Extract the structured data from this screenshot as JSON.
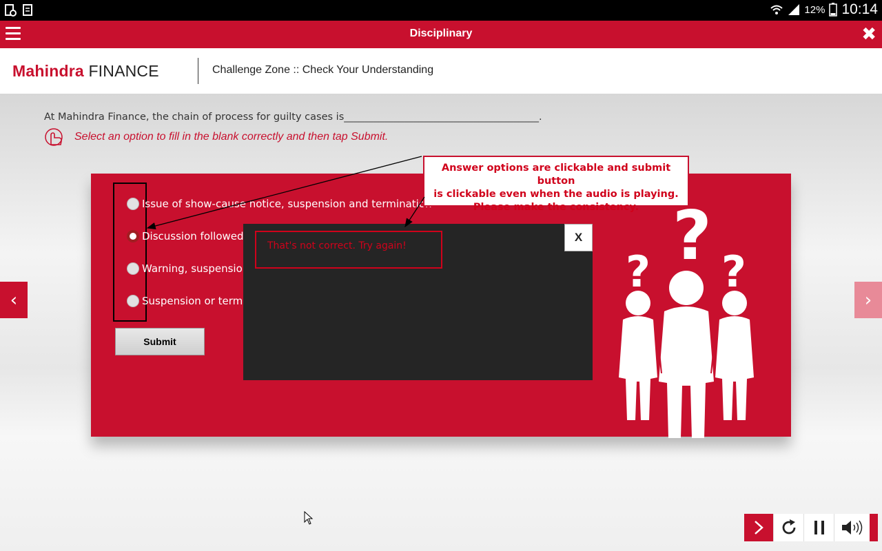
{
  "status_bar": {
    "battery": "12%",
    "time": "10:14"
  },
  "title_bar": {
    "title": "Disciplinary",
    "close_glyph": "✖"
  },
  "header": {
    "logo_brand": "Mahindra",
    "logo_finance": "FINANCE",
    "title": "Challenge Zone :: Check Your Understanding"
  },
  "question": {
    "text": "At Mahindra Finance, the chain of process for guilty cases is_______________________________________.",
    "instruction": "Select an option to fill in the blank correctly and then tap Submit."
  },
  "options": [
    {
      "label": "Issue of show-cause notice, suspension and termination",
      "selected": false
    },
    {
      "label": "Discussion followed",
      "selected": true
    },
    {
      "label": "Warning, suspension",
      "selected": false
    },
    {
      "label": "Suspension or termi",
      "selected": false
    }
  ],
  "submit_label": "Submit",
  "feedback": {
    "message": "That's not correct. Try again!",
    "close_label": "X"
  },
  "callout": {
    "line1": "Answer options are clickable and submit button",
    "line2": "is clickable even when the audio is playing.",
    "line3": "Please make the consistency."
  },
  "nav": {
    "prev_glyph": "‹",
    "next_glyph": "›"
  },
  "colors": {
    "brand_red": "#c8102e",
    "error_red": "#d0021b",
    "dark_popup": "#252525"
  }
}
